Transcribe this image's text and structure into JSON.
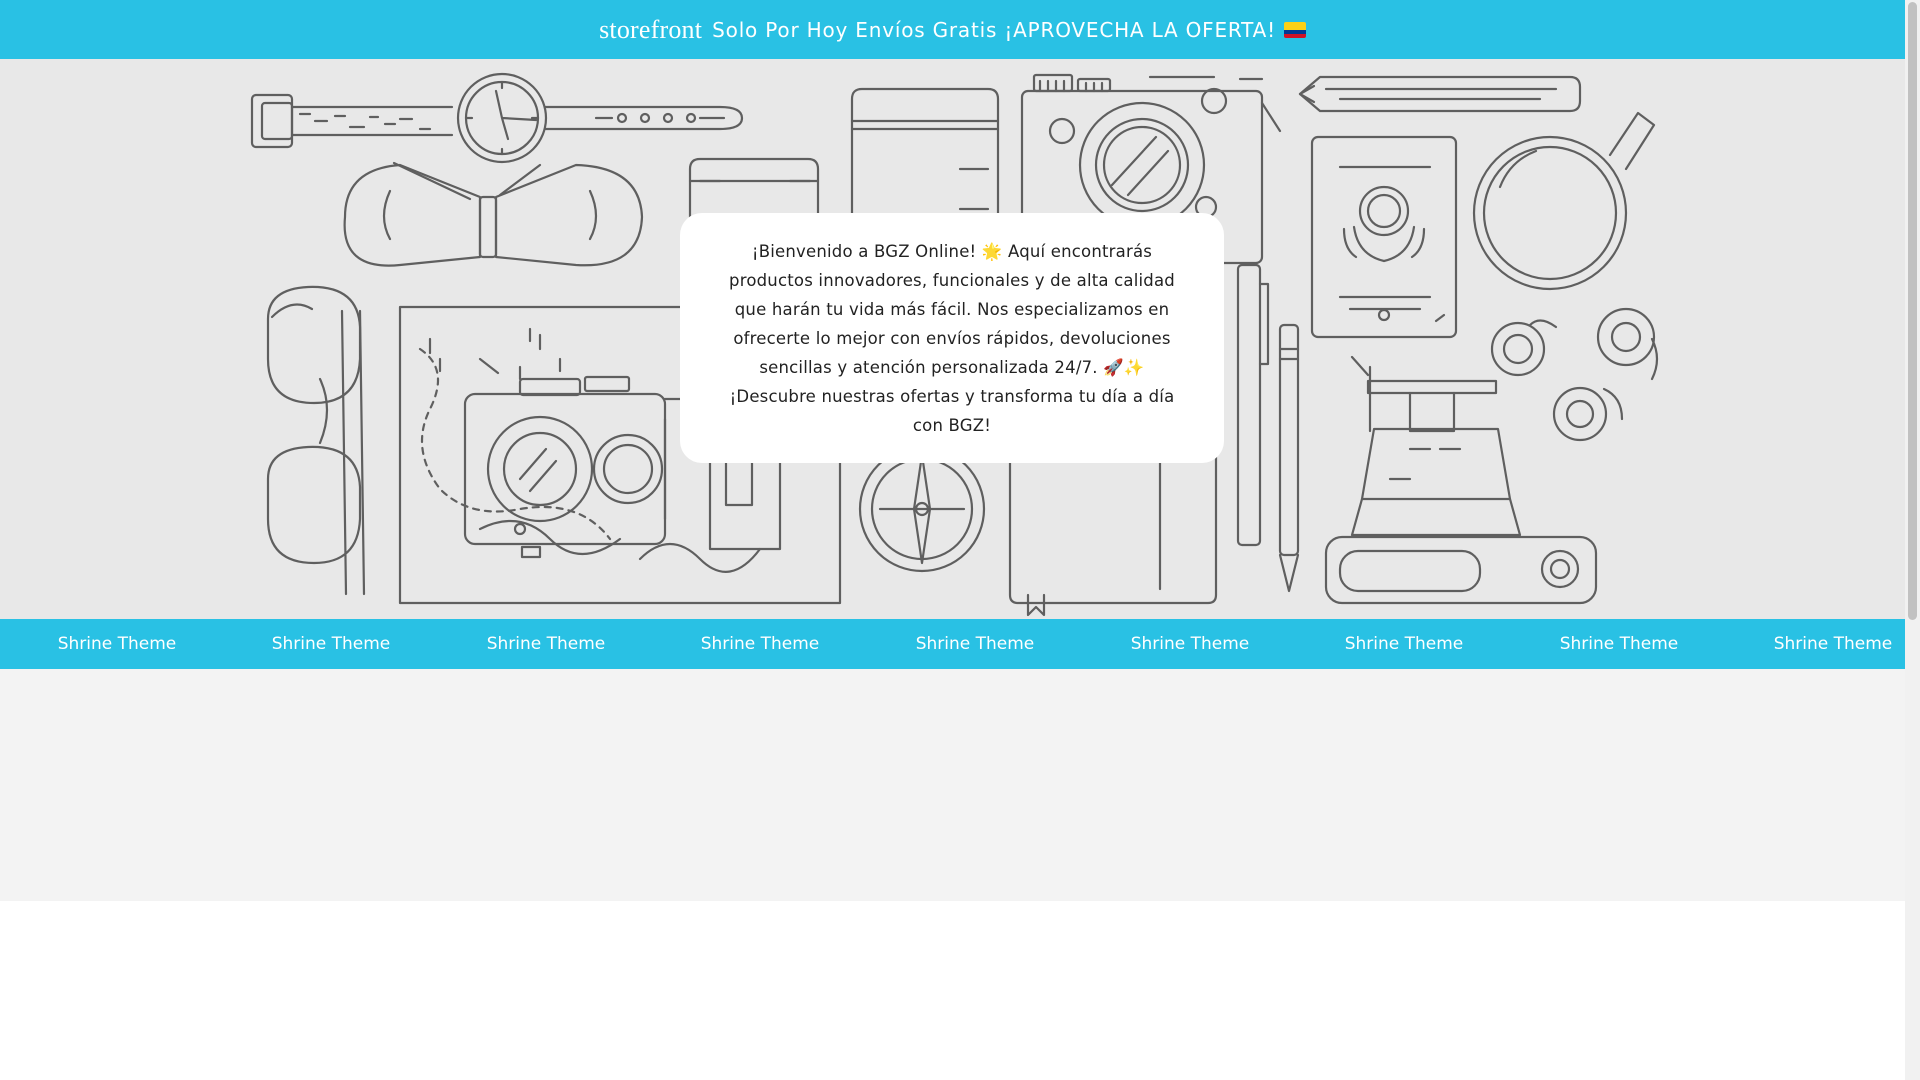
{
  "announcement": {
    "brand": "storefront",
    "message": "Solo Por Hoy Envíos Gratis ¡APROVECHA LA OFERTA!",
    "flag_icon": "colombia-flag-icon",
    "background": "#29c1e4"
  },
  "hero": {
    "illustration_icon": "travel-items-illustration",
    "text": "¡Bienvenido a BGZ Online! 🌟 Aquí encontrarás productos innovadores, funcionales y de alta calidad que harán tu vida más fácil. Nos especializamos en ofrecerte lo mejor con envíos rápidos, devoluciones sencillas y atención personalizada 24/7. 🚀✨ ¡Descubre nuestras ofertas y transforma tu día a día con BGZ!"
  },
  "marquee": {
    "items": [
      "Shrine Theme",
      "Shrine Theme",
      "Shrine Theme",
      "Shrine Theme",
      "Shrine Theme",
      "Shrine Theme",
      "Shrine Theme",
      "Shrine Theme",
      "Shrine Theme"
    ],
    "background": "#29c1e4"
  }
}
